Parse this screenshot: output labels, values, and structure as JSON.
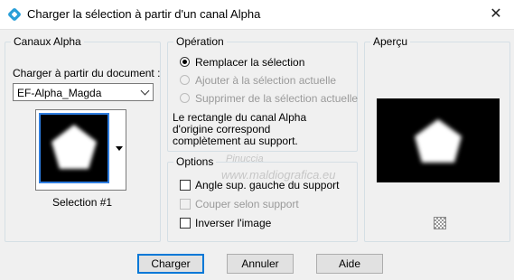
{
  "window": {
    "title": "Charger la sélection à partir d'un canal Alpha",
    "close_glyph": "✕"
  },
  "canaux": {
    "legend": "Canaux Alpha",
    "document_label": "Charger à partir du document :",
    "document_value": "EF-Alpha_Magda",
    "selection_name": "Selection #1"
  },
  "operation": {
    "legend": "Opération",
    "options": [
      {
        "label": "Remplacer la sélection",
        "checked": true,
        "enabled": true
      },
      {
        "label": "Ajouter à la sélection actuelle",
        "checked": false,
        "enabled": false
      },
      {
        "label": "Supprimer de la sélection actuelle",
        "checked": false,
        "enabled": false
      }
    ],
    "info": [
      "Le rectangle du canal Alpha",
      "d'origine correspond",
      "complètement au support."
    ]
  },
  "options": {
    "legend": "Options",
    "checks": [
      {
        "label": "Angle sup. gauche du support",
        "checked": false,
        "enabled": true
      },
      {
        "label": "Couper selon support",
        "checked": false,
        "enabled": false
      },
      {
        "label": "Inverser l'image",
        "checked": false,
        "enabled": true
      }
    ]
  },
  "apercu": {
    "legend": "Aperçu"
  },
  "buttons": {
    "ok": "Charger",
    "cancel": "Annuler",
    "help": "Aide"
  },
  "watermark": {
    "line1": "Pinuccia",
    "line2": "www.maldiografica.eu"
  },
  "colors": {
    "accent": "#0078d7",
    "thumb_border": "#2e7de0"
  }
}
